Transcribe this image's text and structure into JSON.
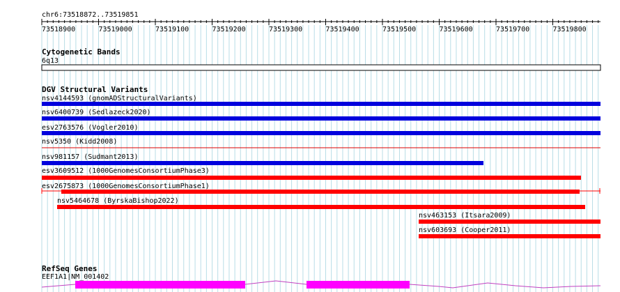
{
  "ruler": {
    "location": "chr6:73518872..73519851",
    "ticks": [
      "73518900",
      "73519000",
      "73519100",
      "73519200",
      "73519300",
      "73519400",
      "73519500",
      "73519600",
      "73519700",
      "73519800"
    ]
  },
  "cytoband": {
    "title": "Cytogenetic Bands",
    "band": "6q13"
  },
  "dgv": {
    "title": "DGV Structural Variants",
    "features": [
      {
        "label": "nsv4144593 (gnomADStructuralVariants)",
        "color": "#0000dd"
      },
      {
        "label": "nsv6400739 (Sedlazeck2020)",
        "color": "#0000dd"
      },
      {
        "label": "esv2763576 (Vogler2010)",
        "color": "#0000dd"
      },
      {
        "label": "nsv5350 (Kidd2008)",
        "color": "#dd0000"
      },
      {
        "label": "nsv981157 (Sudmant2013)",
        "color": "#0000dd"
      },
      {
        "label": "esv3609512 (1000GenomesConsortiumPhase3)",
        "color": "#ff0000"
      },
      {
        "label": "esv2675873 (1000GenomesConsortiumPhase1)",
        "color": "#ff0000"
      },
      {
        "label": "nsv5464678 (ByrskaBishop2022)",
        "color": "#ff0000"
      },
      {
        "label": "nsv463153 (Itsara2009)",
        "color": "#ff0000"
      },
      {
        "label": "nsv603693 (Cooper2011)",
        "color": "#ff0000"
      }
    ]
  },
  "refseq": {
    "title": "RefSeq Genes",
    "gene_label": "EEF1A1|NM_001402",
    "exon_color": "#ff00ff"
  },
  "colors": {
    "grid": "#b8dde6",
    "gain": "#0000dd",
    "loss": "#ff0000"
  }
}
